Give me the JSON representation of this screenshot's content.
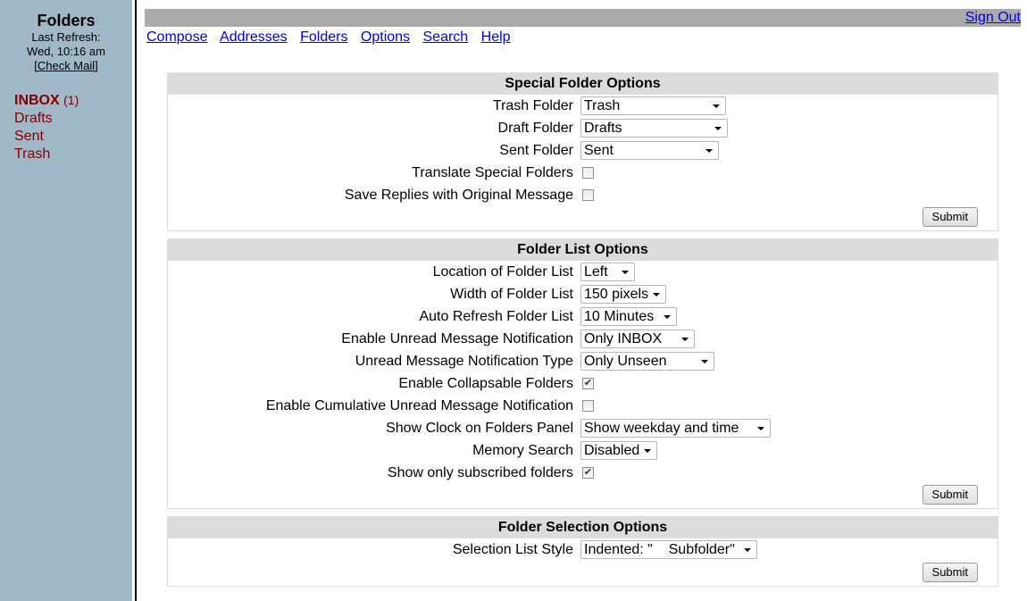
{
  "sidebar": {
    "title": "Folders",
    "last_refresh_label": "Last Refresh:",
    "last_refresh_time": "Wed, 10:16 am",
    "check_mail": "[Check Mail]",
    "folders": [
      {
        "name": "INBOX",
        "count": "(1)"
      },
      {
        "name": "Drafts"
      },
      {
        "name": "Sent"
      },
      {
        "name": "Trash"
      }
    ]
  },
  "header": {
    "sign_out": "Sign Out",
    "nav": [
      "Compose",
      "Addresses",
      "Folders",
      "Options",
      "Search",
      "Help"
    ]
  },
  "sections": [
    {
      "title": "Special Folder Options",
      "submit": "Submit",
      "rows": [
        {
          "label": "Trash Folder",
          "type": "select",
          "value": "Trash"
        },
        {
          "label": "Draft Folder",
          "type": "select",
          "value": "Drafts"
        },
        {
          "label": "Sent Folder",
          "type": "select",
          "value": "Sent"
        },
        {
          "label": "Translate Special Folders",
          "type": "checkbox",
          "checked": false
        },
        {
          "label": "Save Replies with Original Message",
          "type": "checkbox",
          "checked": false
        }
      ]
    },
    {
      "title": "Folder List Options",
      "submit": "Submit",
      "rows": [
        {
          "label": "Location of Folder List",
          "type": "select",
          "value": "Left"
        },
        {
          "label": "Width of Folder List",
          "type": "select",
          "value": "150 pixels"
        },
        {
          "label": "Auto Refresh Folder List",
          "type": "select",
          "value": "10 Minutes"
        },
        {
          "label": "Enable Unread Message Notification",
          "type": "select",
          "value": "Only INBOX"
        },
        {
          "label": "Unread Message Notification Type",
          "type": "select",
          "value": "Only Unseen"
        },
        {
          "label": "Enable Collapsable Folders",
          "type": "checkbox",
          "checked": true
        },
        {
          "label": "Enable Cumulative Unread Message Notification",
          "type": "checkbox",
          "checked": false
        },
        {
          "label": "Show Clock on Folders Panel",
          "type": "select",
          "value": "Show weekday and time"
        },
        {
          "label": "Memory Search",
          "type": "select",
          "value": "Disabled"
        },
        {
          "label": "Show only subscribed folders",
          "type": "checkbox",
          "checked": true
        }
      ]
    },
    {
      "title": "Folder Selection Options",
      "submit": "Submit",
      "rows": [
        {
          "label": "Selection List Style",
          "type": "select",
          "value": "Indented: \"    Subfolder\""
        }
      ]
    }
  ]
}
